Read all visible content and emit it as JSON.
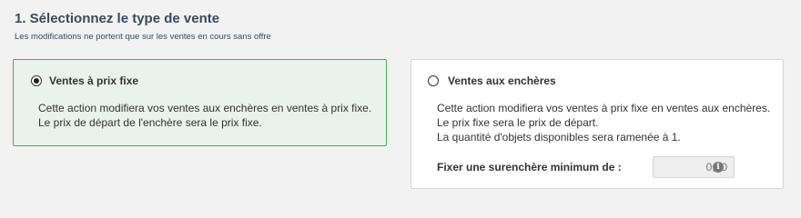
{
  "section": {
    "title": "1. Sélectionnez le type de vente",
    "subtitle": "Les modifications ne portent que sur les ventes en cours sans offre"
  },
  "options": {
    "fixed": {
      "label": "Ventes à prix fixe",
      "selected": true,
      "desc_lines": [
        "Cette action modifiera vos ventes aux enchères en ventes à prix fixe.",
        "Le prix de départ de l'enchère sera le prix fixe."
      ]
    },
    "auction": {
      "label": "Ventes aux enchères",
      "selected": false,
      "desc_lines": [
        "Cette action modifiera vos ventes à prix fixe en ventes aux enchères.",
        "Le prix fixe sera le prix de départ.",
        "La quantité d'objets disponibles sera ramenée à 1."
      ],
      "min_bid_label": "Fixer une surenchère minimum de :",
      "min_bid_placeholder": "0,00",
      "info_icon": "info-icon"
    }
  },
  "colors": {
    "selected_border": "#4caf50",
    "selected_bg": "#e9f2ec",
    "title": "#3a4a5a"
  }
}
